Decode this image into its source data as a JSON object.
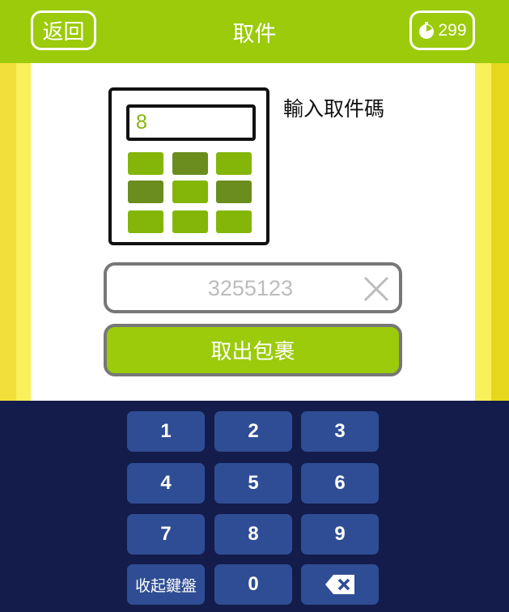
{
  "header": {
    "back_label": "返回",
    "title": "取件",
    "coins": "299",
    "coin_icon": "timer-coin-icon"
  },
  "calculator": {
    "display": "8"
  },
  "prompt": "輸入取件碼",
  "code_input": {
    "value": "3255123",
    "clear_icon": "close-icon"
  },
  "submit_label": "取出包裹",
  "keypad": {
    "keys": [
      "1",
      "2",
      "3",
      "4",
      "5",
      "6",
      "7",
      "8",
      "9"
    ],
    "collapse_label": "收起鍵盤",
    "zero": "0",
    "backspace_icon": "backspace-icon"
  },
  "colors": {
    "brand_green": "#9bcb0b",
    "keypad_bg": "#131c4a",
    "key_bg": "#2f4d94",
    "side_yellow": "#faf059"
  }
}
